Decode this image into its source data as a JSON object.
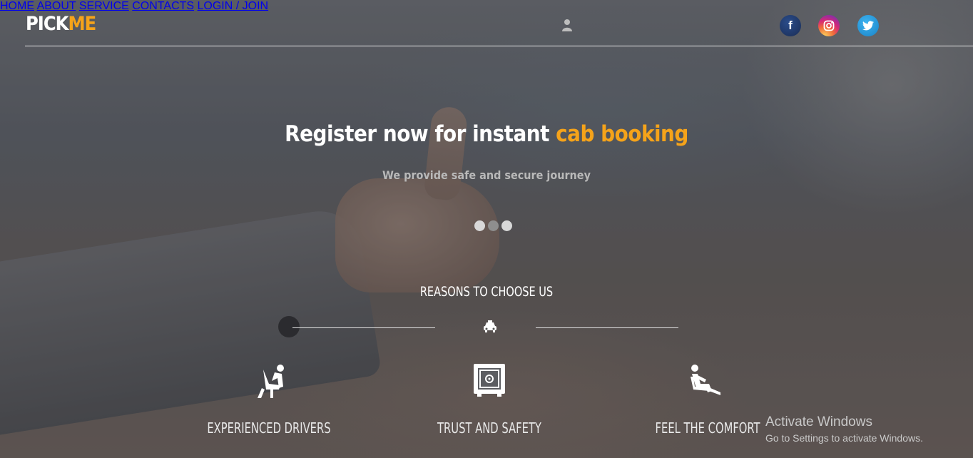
{
  "brand": {
    "part1": "PICK",
    "part2": "ME",
    "accent_color": "#f5a31a"
  },
  "nav": {
    "items": [
      {
        "label": "HOME"
      },
      {
        "label": "ABOUT"
      },
      {
        "label": "SERVICE"
      },
      {
        "label": "CONTACTS"
      }
    ],
    "login_label": "LOGIN / JOIN"
  },
  "social": [
    {
      "name": "facebook-icon",
      "glyph": "f"
    },
    {
      "name": "instagram-icon",
      "glyph": "◎"
    },
    {
      "name": "twitter-icon",
      "glyph": "t"
    }
  ],
  "hero": {
    "title_main": "Register now for instant ",
    "title_accent": "cab booking",
    "subtitle": "We provide safe and secure journey",
    "carousel": {
      "count": 3,
      "active_index": 1
    }
  },
  "reasons": {
    "title": "REASONS TO CHOOSE US",
    "features": [
      {
        "icon": "driver-seat-icon",
        "label": "EXPERIENCED DRIVERS"
      },
      {
        "icon": "safe-icon",
        "label": "TRUST AND SAFETY"
      },
      {
        "icon": "comfort-seat-icon",
        "label": "FEEL THE COMFORT"
      }
    ]
  },
  "watermark": {
    "line1": "Activate Windows",
    "line2": "Go to Settings to activate Windows."
  }
}
